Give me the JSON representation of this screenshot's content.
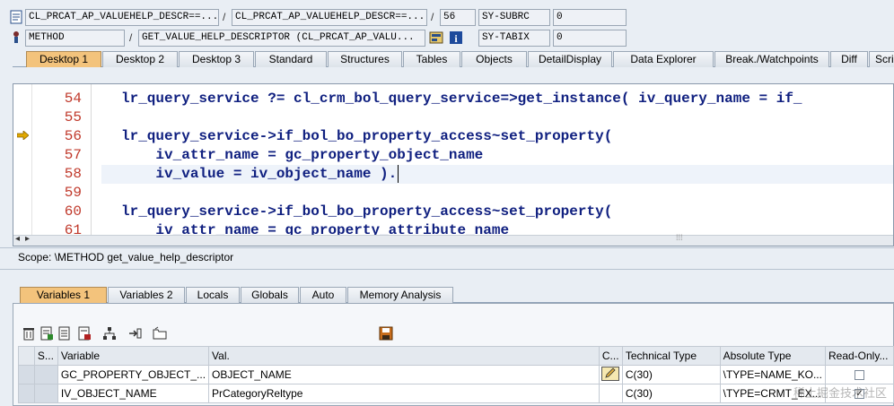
{
  "top_fields": {
    "program": "CL_PRCAT_AP_VALUEHELP_DESCR==...",
    "include": "CL_PRCAT_AP_VALUEHELP_DESCR==...",
    "line": "56",
    "sy_subrc_label": "SY-SUBRC",
    "sy_subrc_value": "0",
    "event_type": "METHOD",
    "event_name": "GET_VALUE_HELP_DESCRIPTOR (CL_PRCAT_AP_VALU...",
    "sy_tabix_label": "SY-TABIX",
    "sy_tabix_value": "0"
  },
  "desktop_tabs": [
    "Desktop 1",
    "Desktop 2",
    "Desktop 3",
    "Standard",
    "Structures",
    "Tables",
    "Objects",
    "DetailDisplay",
    "Data Explorer",
    "Break./Watchpoints",
    "Diff",
    "Scrip"
  ],
  "code": {
    "lines": [
      {
        "num": "54",
        "text": "lr_query_service ?= cl_crm_bol_query_service=>get_instance( iv_query_name = if_"
      },
      {
        "num": "55",
        "text": ""
      },
      {
        "num": "56",
        "text": "lr_query_service->if_bol_bo_property_access~set_property("
      },
      {
        "num": "57",
        "text": "    iv_attr_name = gc_property_object_name"
      },
      {
        "num": "58",
        "text": "    iv_value = iv_object_name )."
      },
      {
        "num": "59",
        "text": ""
      },
      {
        "num": "60",
        "text": "lr_query_service->if_bol_bo_property_access~set_property("
      },
      {
        "num": "61",
        "text": "    iv_attr_name = gc_property_attribute_name"
      }
    ],
    "current_line": "56",
    "highlight_line": "58"
  },
  "scope": "Scope: \\METHOD get_value_help_descriptor",
  "variable_tabs": [
    "Variables 1",
    "Variables 2",
    "Locals",
    "Globals",
    "Auto",
    "Memory Analysis"
  ],
  "table": {
    "columns": [
      "S...",
      "Variable",
      "Val.",
      "C...",
      "Technical Type",
      "Absolute Type",
      "Read-Only..."
    ],
    "rows": [
      {
        "variable": "GC_PROPERTY_OBJECT_...",
        "value": "OBJECT_NAME",
        "tech_type": "C(30)",
        "abs_type": "\\TYPE=NAME_KO...",
        "readonly": false
      },
      {
        "variable": "IV_OBJECT_NAME",
        "value": "PrCategoryReltype",
        "tech_type": "C(30)",
        "abs_type": "\\TYPE=CRMT_EX...",
        "readonly": true
      }
    ]
  },
  "watermark": "稀土掘金技术社区",
  "colors": {
    "active_tab": "#f3c37c",
    "code_keyword": "#102080",
    "line_number": "#c0392b",
    "current_line_arrow": "#e0a800"
  }
}
